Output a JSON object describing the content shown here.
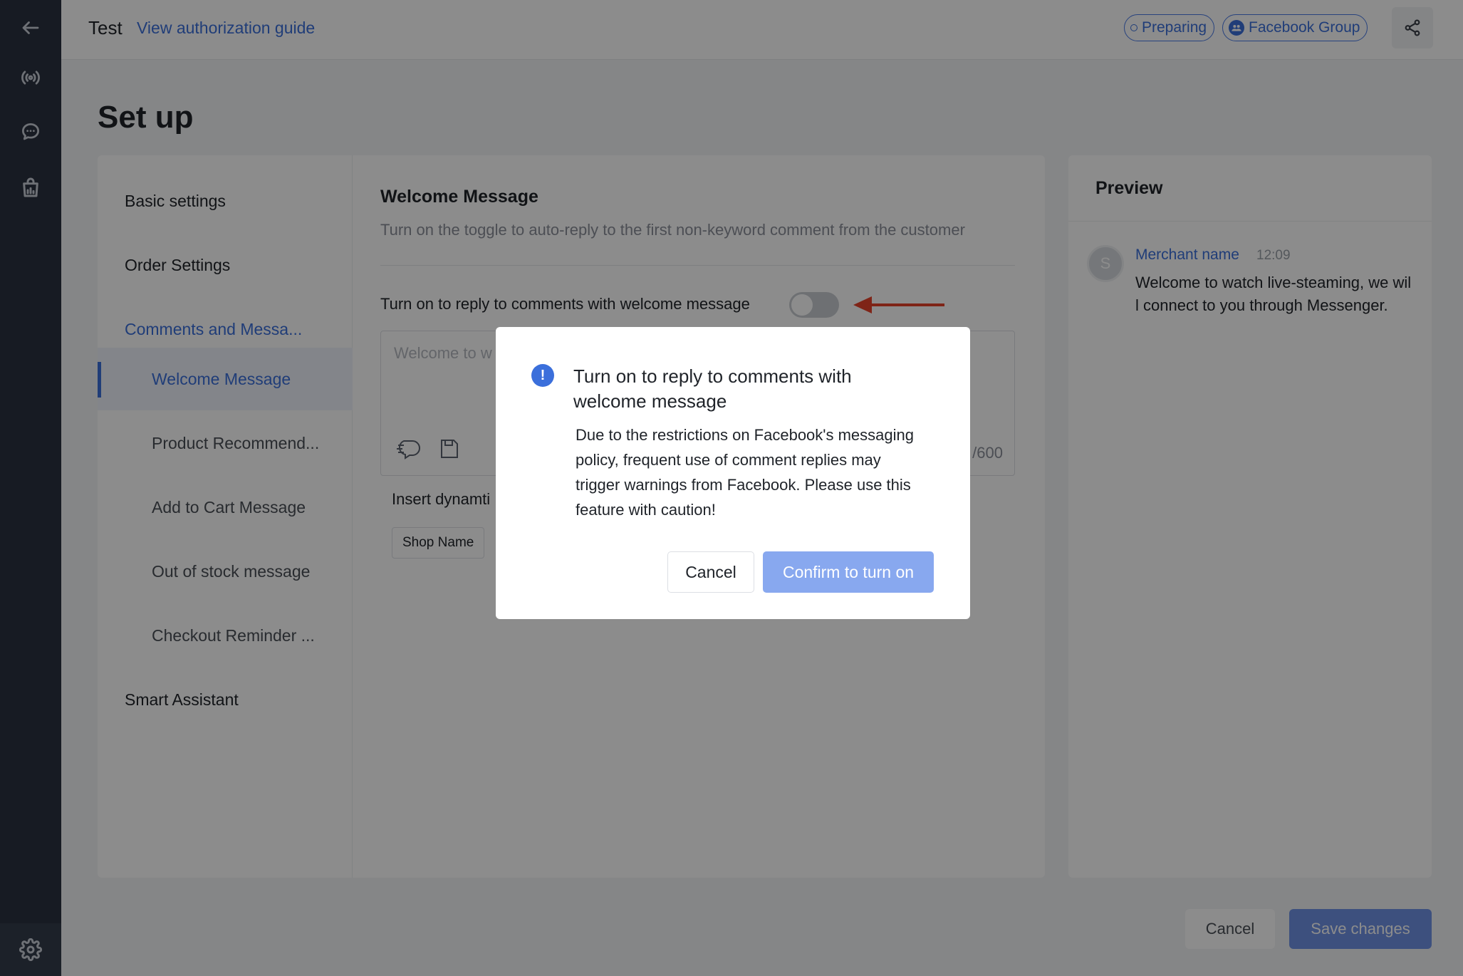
{
  "header": {
    "title": "Test",
    "guide_link": "View authorization guide",
    "status_badge": "Preparing",
    "platform_badge": "Facebook Group"
  },
  "page": {
    "title": "Set up"
  },
  "nav": {
    "items": [
      {
        "label": "Basic settings"
      },
      {
        "label": "Order Settings"
      },
      {
        "label": "Comments and Messa..."
      },
      {
        "label": "Welcome Message"
      },
      {
        "label": "Product Recommend..."
      },
      {
        "label": "Add to Cart Message"
      },
      {
        "label": "Out of stock message"
      },
      {
        "label": "Checkout Reminder ..."
      },
      {
        "label": "Smart Assistant"
      }
    ]
  },
  "section": {
    "title": "Welcome Message",
    "description": "Turn on the toggle to auto-reply to the first non-keyword comment from the customer",
    "toggle_label": "Turn on to reply to comments with welcome message",
    "toggle_on": false,
    "textarea_placeholder": "Welcome to w",
    "counter": "/600",
    "insert_label": "Insert dynamti",
    "chip_shop_name": "Shop Name"
  },
  "preview": {
    "title": "Preview",
    "avatar_letter": "S",
    "merchant_name": "Merchant name",
    "time": "12:09",
    "message": "Welcome to watch live-steaming, we will connect to you through Messenger."
  },
  "footer": {
    "cancel_label": "Cancel",
    "save_label": "Save changes"
  },
  "modal": {
    "icon": "!",
    "title": "Turn on to reply to comments with welcome message",
    "body": "Due to the restrictions on Facebook's messaging policy, frequent use of comment replies may trigger warnings from Facebook. Please use this feature with caution!",
    "cancel_label": "Cancel",
    "confirm_label": "Confirm to turn on"
  },
  "colors": {
    "accent": "#3b6fdb",
    "rail": "#2b3240",
    "arrow": "#e8432b"
  }
}
